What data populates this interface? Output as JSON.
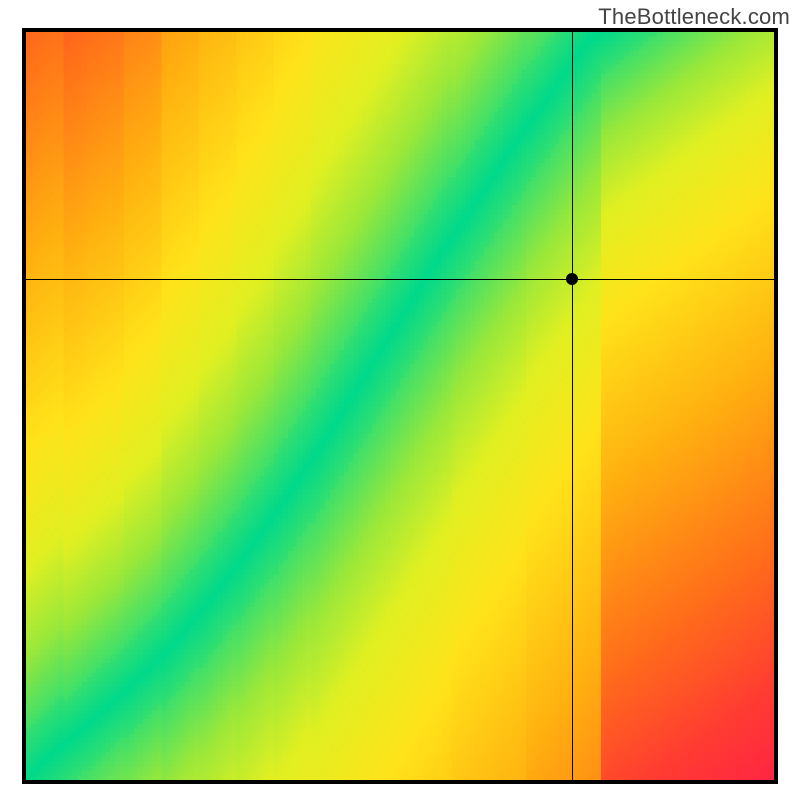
{
  "attribution": "TheBottleneck.com",
  "chart_data": {
    "type": "heatmap",
    "title": "",
    "xlabel": "",
    "ylabel": "",
    "xlim": [
      0,
      1
    ],
    "ylim": [
      0,
      1
    ],
    "marker": {
      "x_frac": 0.73,
      "y_frac": 0.67
    },
    "curve_points": [
      {
        "x": 0.0,
        "y": 0.0
      },
      {
        "x": 0.03,
        "y": 0.03
      },
      {
        "x": 0.06,
        "y": 0.055
      },
      {
        "x": 0.1,
        "y": 0.09
      },
      {
        "x": 0.15,
        "y": 0.135
      },
      {
        "x": 0.2,
        "y": 0.185
      },
      {
        "x": 0.25,
        "y": 0.245
      },
      {
        "x": 0.3,
        "y": 0.31
      },
      {
        "x": 0.35,
        "y": 0.38
      },
      {
        "x": 0.4,
        "y": 0.455
      },
      {
        "x": 0.45,
        "y": 0.535
      },
      {
        "x": 0.5,
        "y": 0.615
      },
      {
        "x": 0.55,
        "y": 0.695
      },
      {
        "x": 0.6,
        "y": 0.77
      },
      {
        "x": 0.65,
        "y": 0.845
      },
      {
        "x": 0.7,
        "y": 0.915
      },
      {
        "x": 0.75,
        "y": 0.985
      },
      {
        "x": 0.77,
        "y": 1.0
      }
    ],
    "band_half_width": 0.045,
    "color_stops": [
      {
        "t": 0.0,
        "hex": "#00D98B"
      },
      {
        "t": 0.07,
        "hex": "#3EE06B"
      },
      {
        "t": 0.14,
        "hex": "#9BE83A"
      },
      {
        "t": 0.22,
        "hex": "#E1F022"
      },
      {
        "t": 0.33,
        "hex": "#FFE31A"
      },
      {
        "t": 0.5,
        "hex": "#FFB210"
      },
      {
        "t": 0.7,
        "hex": "#FF6E1A"
      },
      {
        "t": 0.85,
        "hex": "#FF3B33"
      },
      {
        "t": 1.0,
        "hex": "#FF194C"
      }
    ],
    "grid": false,
    "pixelated": true,
    "resolution": 160
  }
}
